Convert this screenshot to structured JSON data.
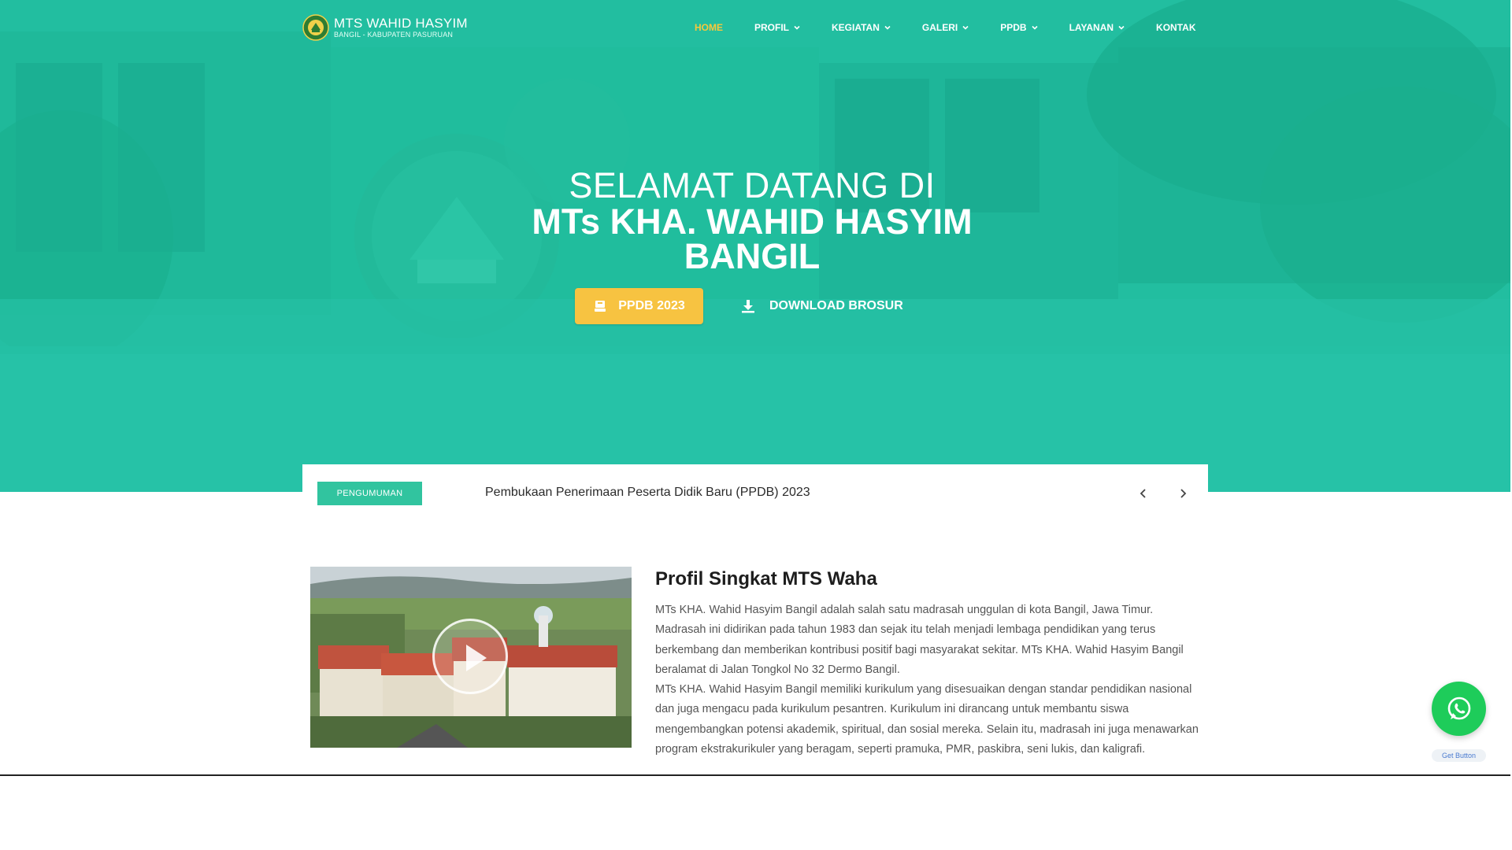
{
  "site": {
    "logo_title": "MTS WAHID HASYIM",
    "logo_subtitle": "BANGIL - KABUPATEN PASURUAN"
  },
  "nav": {
    "items": [
      {
        "label": "HOME",
        "active": true,
        "dropdown": false
      },
      {
        "label": "PROFIL",
        "active": false,
        "dropdown": true
      },
      {
        "label": "KEGIATAN",
        "active": false,
        "dropdown": true
      },
      {
        "label": "GALERI",
        "active": false,
        "dropdown": true
      },
      {
        "label": "PPDB",
        "active": false,
        "dropdown": true
      },
      {
        "label": "LAYANAN",
        "active": false,
        "dropdown": true
      },
      {
        "label": "KONTAK",
        "active": false,
        "dropdown": false
      }
    ]
  },
  "hero": {
    "line1": "SELAMAT DATANG DI",
    "line2a": "MTs KHA. WAHID HASYIM",
    "line2b": "BANGIL",
    "btn_ppdb": "PPDB 2023",
    "btn_brosur": "DOWNLOAD BROSUR"
  },
  "announcement": {
    "badge": "PENGUMUMAN",
    "text": "Pembukaan Penerimaan Peserta Didik Baru (PPDB) 2023"
  },
  "profile": {
    "title": "Profil Singkat MTS Waha",
    "para1": "MTs KHA. Wahid Hasyim Bangil adalah salah satu madrasah unggulan di kota Bangil, Jawa Timur. Madrasah ini didirikan pada tahun 1983 dan sejak itu telah menjadi lembaga pendidikan yang terus berkembang dan memberikan kontribusi positif bagi masyarakat sekitar. MTs KHA. Wahid Hasyim Bangil beralamat di Jalan Tongkol No 32 Dermo Bangil.",
    "para2": "MTs KHA. Wahid Hasyim Bangil memiliki kurikulum yang disesuaikan dengan standar pendidikan nasional dan juga mengacu pada kurikulum pesantren. Kurikulum ini dirancang untuk membantu siswa mengembangkan potensi akademik, spiritual, dan sosial mereka. Selain itu, madrasah ini juga menawarkan program ekstrakurikuler yang beragam, seperti pramuka, PMR, paskibra, seni lukis, dan kaligrafi."
  },
  "whatsapp": {
    "label": "Get Button"
  },
  "colors": {
    "hero_teal": "#2bc0a8",
    "accent_yellow": "#f7c341",
    "badge_green": "#31c49f",
    "whatsapp_green": "#1ecc5a"
  },
  "icons": {
    "logo": "school-emblem-icon",
    "chevron": "chevron-down-icon",
    "ppdb": "student-icon",
    "brosur": "download-icon",
    "prev": "chevron-left-icon",
    "next": "chevron-right-icon",
    "play": "play-icon",
    "whatsapp": "whatsapp-icon"
  }
}
